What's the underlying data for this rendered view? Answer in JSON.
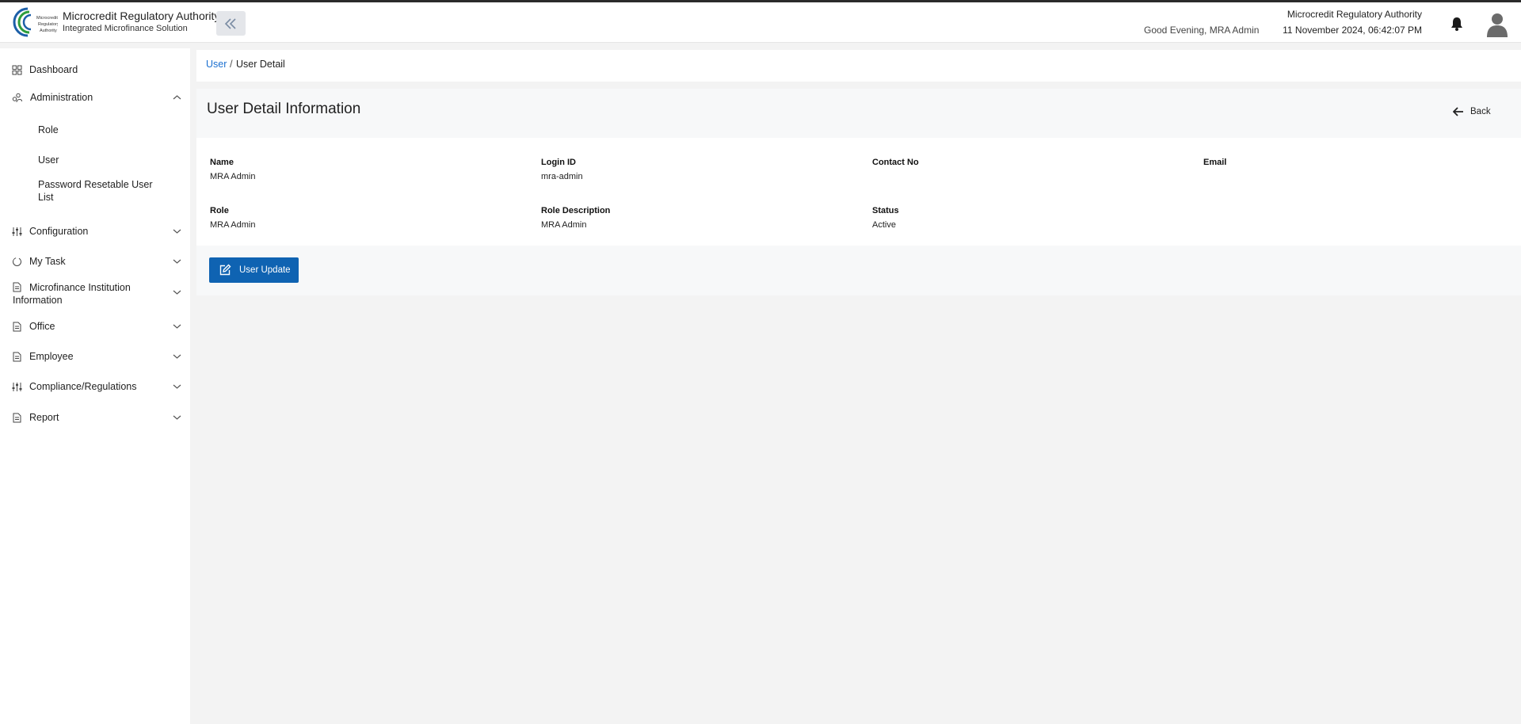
{
  "header": {
    "brand_title": "Microcredit Regulatory Authority",
    "brand_subtitle": "Integrated Microfinance Solution",
    "logo_text": "Microcredit Regulatory Authority",
    "greeting": "Good Evening, MRA Admin",
    "org_name": "Microcredit Regulatory Authority",
    "datetime": "11 November 2024, 06:42:07 PM"
  },
  "sidebar": {
    "items": [
      {
        "label": "Dashboard",
        "icon": "grid-icon"
      },
      {
        "label": "Administration",
        "icon": "users-icon",
        "expanded": true
      },
      {
        "label": "Configuration",
        "icon": "sliders-icon"
      },
      {
        "label": "My Task",
        "icon": "circle-icon"
      },
      {
        "label": "Microfinance Institution Information",
        "icon": "document-icon"
      },
      {
        "label": "Office",
        "icon": "document-icon"
      },
      {
        "label": "Employee",
        "icon": "document-icon"
      },
      {
        "label": "Compliance/Regulations",
        "icon": "sliders-icon"
      },
      {
        "label": "Report",
        "icon": "document-icon"
      }
    ],
    "admin_subitems": [
      "Role",
      "User",
      "Password Resetable User List"
    ]
  },
  "breadcrumb": {
    "link": "User",
    "separator": "/",
    "current": "User Detail"
  },
  "page": {
    "title": "User Detail Information",
    "back_label": "Back"
  },
  "details": {
    "name_label": "Name",
    "name_value": "MRA Admin",
    "login_label": "Login ID",
    "login_value": "mra-admin",
    "contact_label": "Contact No",
    "contact_value": "",
    "email_label": "Email",
    "email_value": "",
    "role_label": "Role",
    "role_value": "MRA Admin",
    "role_desc_label": "Role Description",
    "role_desc_value": "MRA Admin",
    "status_label": "Status",
    "status_value": "Active"
  },
  "actions": {
    "update_label": "User Update"
  },
  "colors": {
    "accent": "#0f63b2",
    "link": "#1a6fd0",
    "logo_green": "#2e9e3c",
    "logo_blue": "#1c5fa8"
  }
}
